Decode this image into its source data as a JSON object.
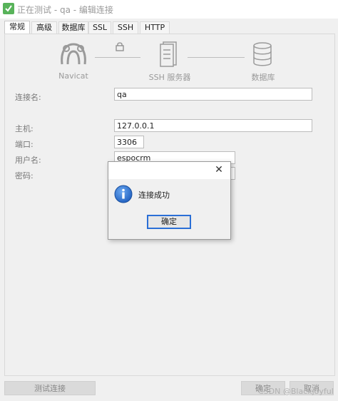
{
  "window": {
    "title": "正在测试 - qa - 编辑连接"
  },
  "tabs": [
    "常规",
    "高级",
    "数据库",
    "SSL",
    "SSH",
    "HTTP"
  ],
  "diagram": {
    "left_label": "Navicat",
    "middle_label": "SSH 服务器",
    "right_label": "数据库"
  },
  "form": {
    "connection_name_label": "连接名:",
    "connection_name_value": "qa",
    "host_label": "主机:",
    "host_value": "127.0.0.1",
    "port_label": "端口:",
    "port_value": "3306",
    "username_label": "用户名:",
    "username_value": "espocrm",
    "password_label": "密码:"
  },
  "footer": {
    "test_button": "测试连接",
    "ok_button": "确定",
    "cancel_button": "取消"
  },
  "dialog": {
    "message": "连接成功",
    "ok_label": "确定"
  },
  "watermark": "CSDN @Blackjoyful",
  "colors": {
    "accent": "#2a6fd6",
    "app_icon": "#58b35a",
    "info_icon": "#1f5fbf"
  },
  "icons": {
    "app": "navicat-app-icon",
    "close": "close-icon",
    "info": "info-icon",
    "lock": "lock-icon",
    "server": "server-icon",
    "database": "database-icon",
    "navicat": "navicat-logo-icon"
  }
}
